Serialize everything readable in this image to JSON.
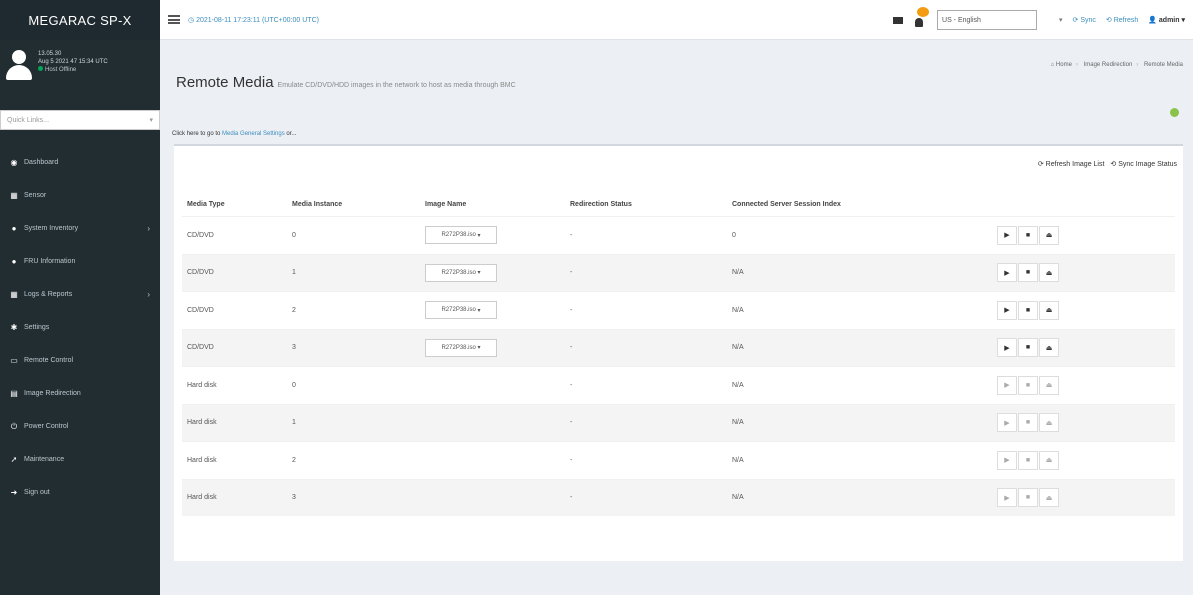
{
  "brand": "MEGARAC SP-X",
  "user": {
    "name": "13.05.30",
    "login_time": "Aug 5 2021 47 15:34 UTC",
    "status": "Host Offline"
  },
  "quick_links": {
    "placeholder": "Quick Links..."
  },
  "nav": [
    {
      "label": "Dashboard",
      "icon": "dashboard-icon",
      "glyph": "◉",
      "arrow": ""
    },
    {
      "label": "Sensor",
      "icon": "sensor-icon",
      "glyph": "▦",
      "arrow": ""
    },
    {
      "label": "System Inventory",
      "icon": "inventory-icon",
      "glyph": "●",
      "arrow": "›"
    },
    {
      "label": "FRU Information",
      "icon": "fru-icon",
      "glyph": "●",
      "arrow": ""
    },
    {
      "label": "Logs & Reports",
      "icon": "logs-icon",
      "glyph": "▦",
      "arrow": "›"
    },
    {
      "label": "Settings",
      "icon": "settings-icon",
      "glyph": "✱",
      "arrow": ""
    },
    {
      "label": "Remote Control",
      "icon": "monitor-icon",
      "glyph": "▭",
      "arrow": ""
    },
    {
      "label": "Image Redirection",
      "icon": "image-redirect-icon",
      "glyph": "▤",
      "arrow": ""
    },
    {
      "label": "Power Control",
      "icon": "power-icon",
      "glyph": "⏻",
      "arrow": ""
    },
    {
      "label": "Maintenance",
      "icon": "wrench-icon",
      "glyph": "➚",
      "arrow": ""
    },
    {
      "label": "Sign out",
      "icon": "signout-icon",
      "glyph": "➜",
      "arrow": ""
    }
  ],
  "topbar": {
    "datetime": "2021-08-11 17:23:11 (UTC+00:00 UTC)",
    "language": "US - English",
    "sync": "Sync",
    "refresh": "Refresh",
    "admin": "admin"
  },
  "page": {
    "title": "Remote Media",
    "subtitle": "Emulate CD/DVD/HDD images in the network to host as media through BMC",
    "breadcrumb": [
      "Home",
      "Image Redirection",
      "Remote Media"
    ],
    "goto_prefix": "Click here to go to",
    "goto_link": "Media General Settings",
    "goto_suffix": "or..."
  },
  "tools": {
    "refresh_list": "Refresh Image List",
    "sync_status": "Sync Image Status"
  },
  "table": {
    "headers": [
      "Media Type",
      "Media Instance",
      "Image Name",
      "Redirection Status",
      "Connected Server Session Index"
    ],
    "rows": [
      {
        "type": "CD/DVD",
        "instance": "0",
        "image": "R272P38.iso",
        "status": "-",
        "session": "0"
      },
      {
        "type": "CD/DVD",
        "instance": "1",
        "image": "R272P38.iso",
        "status": "-",
        "session": "N/A"
      },
      {
        "type": "CD/DVD",
        "instance": "2",
        "image": "R272P38.iso",
        "status": "-",
        "session": "N/A"
      },
      {
        "type": "CD/DVD",
        "instance": "3",
        "image": "R272P38.iso",
        "status": "-",
        "session": "N/A"
      },
      {
        "type": "Hard disk",
        "instance": "0",
        "image": "",
        "status": "-",
        "session": "N/A"
      },
      {
        "type": "Hard disk",
        "instance": "1",
        "image": "",
        "status": "-",
        "session": "N/A"
      },
      {
        "type": "Hard disk",
        "instance": "2",
        "image": "",
        "status": "-",
        "session": "N/A"
      },
      {
        "type": "Hard disk",
        "instance": "3",
        "image": "",
        "status": "-",
        "session": "N/A"
      }
    ]
  },
  "controls": {
    "play": "▶",
    "stop": "■",
    "eject": "⏏"
  },
  "colors": {
    "sidebar": "#222d32",
    "accent": "#3c8dbc",
    "notify": "#f39c12",
    "help": "#8bc34a"
  }
}
